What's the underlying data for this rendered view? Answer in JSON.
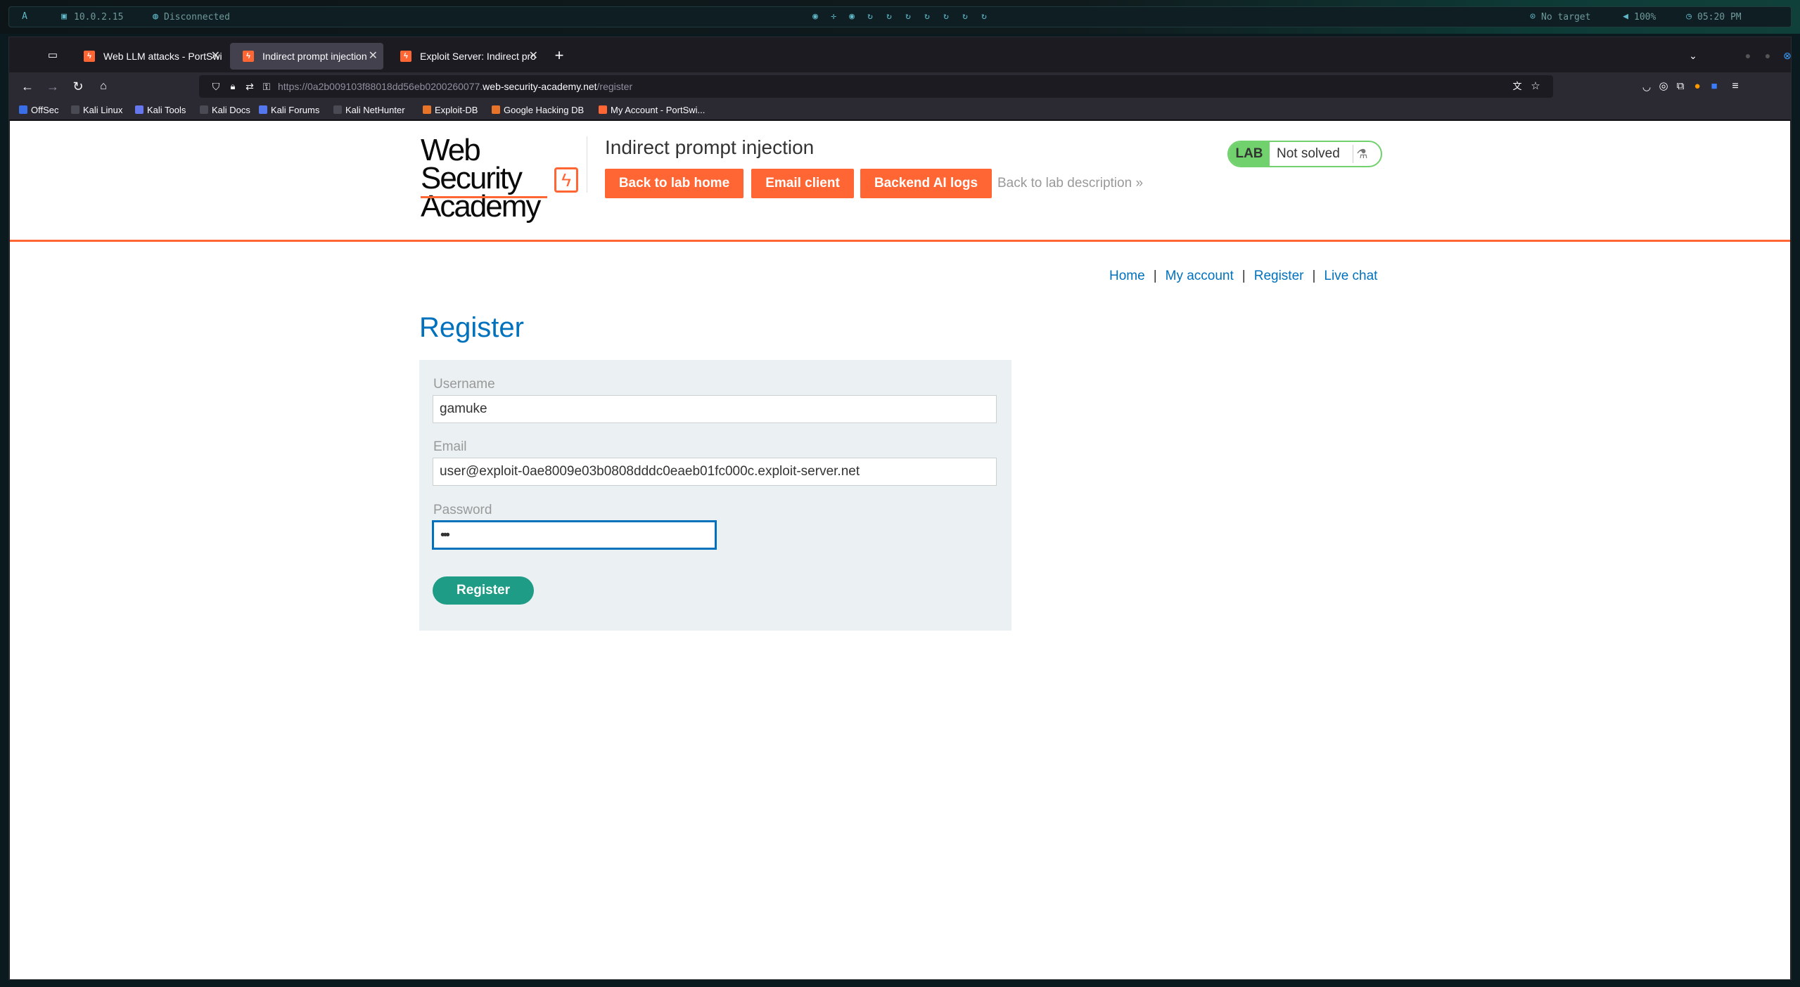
{
  "desktop": {
    "ip": "10.0.2.15",
    "vpn": "Disconnected",
    "target": "No target",
    "volume": "100%",
    "clock": "05:20 PM"
  },
  "browser": {
    "tabs": [
      {
        "label": "Web LLM attacks - PortSwi"
      },
      {
        "label": "Indirect prompt injection"
      },
      {
        "label": "Exploit Server: Indirect pro"
      }
    ],
    "url_prefix": "https://0a2b009103f88018dd56eb0200260077.",
    "url_domain": "web-security-academy.net",
    "url_path": "/register",
    "bookmarks": [
      "OffSec",
      "Kali Linux",
      "Kali Tools",
      "Kali Docs",
      "Kali Forums",
      "Kali NetHunter",
      "Exploit-DB",
      "Google Hacking DB",
      "My Account - PortSwi..."
    ]
  },
  "lab": {
    "logo_line1": "Web Security",
    "logo_line2": "Academy",
    "title": "Indirect prompt injection",
    "btn_back": "Back to lab home",
    "btn_email": "Email client",
    "btn_logs": "Backend AI logs",
    "back_desc": "Back to lab description",
    "badge_tag": "LAB",
    "badge_status": "Not solved"
  },
  "nav": {
    "home": "Home",
    "account": "My account",
    "register": "Register",
    "chat": "Live chat",
    "sep": "|"
  },
  "form": {
    "heading": "Register",
    "username_label": "Username",
    "username_value": "gamuke",
    "email_label": "Email",
    "email_value": "user@exploit-0ae8009e03b0808dddc0eaeb01fc000c.exploit-server.net",
    "password_label": "Password",
    "password_mask": "•••",
    "submit": "Register"
  }
}
